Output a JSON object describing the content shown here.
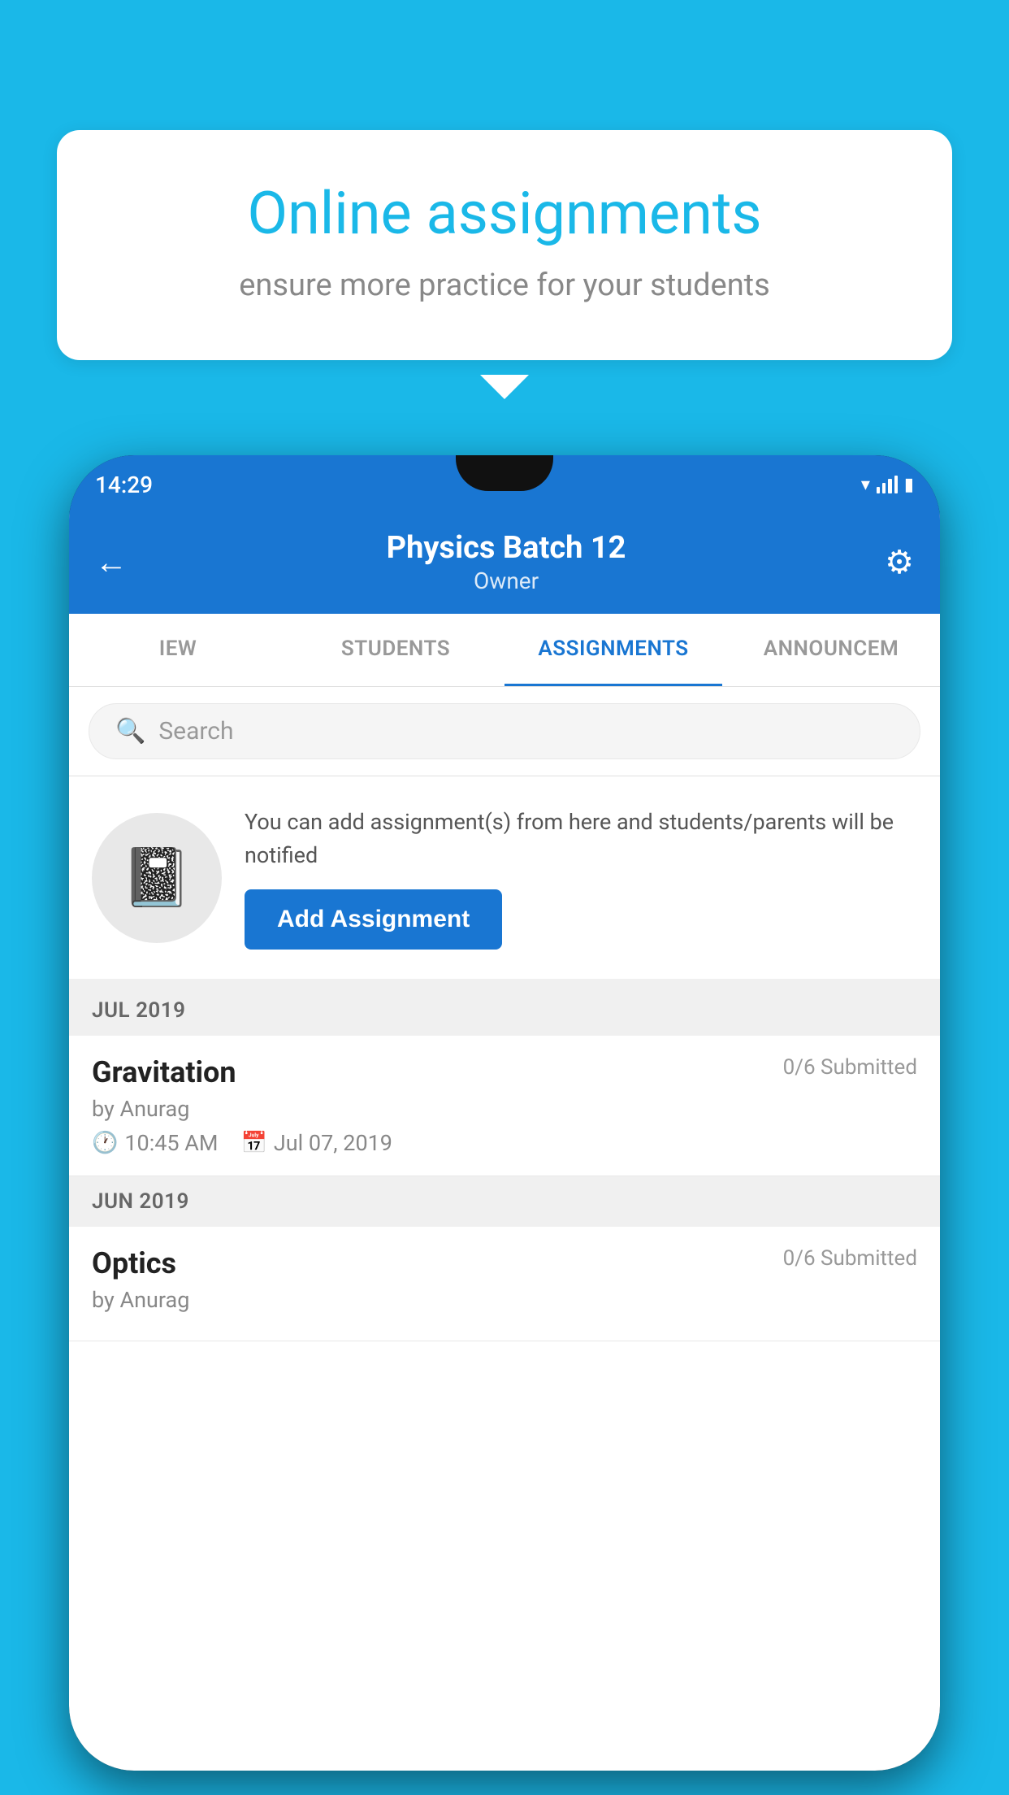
{
  "background_color": "#1ab8e8",
  "speech_bubble": {
    "title": "Online assignments",
    "subtitle": "ensure more practice for your students"
  },
  "phone": {
    "status_bar": {
      "time": "14:29"
    },
    "header": {
      "title": "Physics Batch 12",
      "subtitle": "Owner",
      "back_label": "←",
      "gear_label": "⚙"
    },
    "tabs": [
      {
        "label": "IEW",
        "active": false
      },
      {
        "label": "STUDENTS",
        "active": false
      },
      {
        "label": "ASSIGNMENTS",
        "active": true
      },
      {
        "label": "ANNOUNCEM",
        "active": false
      }
    ],
    "search": {
      "placeholder": "Search"
    },
    "promo": {
      "description": "You can add assignment(s) from here and students/parents will be notified",
      "button_label": "Add Assignment"
    },
    "sections": [
      {
        "month": "JUL 2019",
        "assignments": [
          {
            "title": "Gravitation",
            "submitted": "0/6 Submitted",
            "author": "by Anurag",
            "time": "10:45 AM",
            "date": "Jul 07, 2019"
          }
        ]
      },
      {
        "month": "JUN 2019",
        "assignments": [
          {
            "title": "Optics",
            "submitted": "0/6 Submitted",
            "author": "by Anurag",
            "time": "",
            "date": ""
          }
        ]
      }
    ]
  }
}
